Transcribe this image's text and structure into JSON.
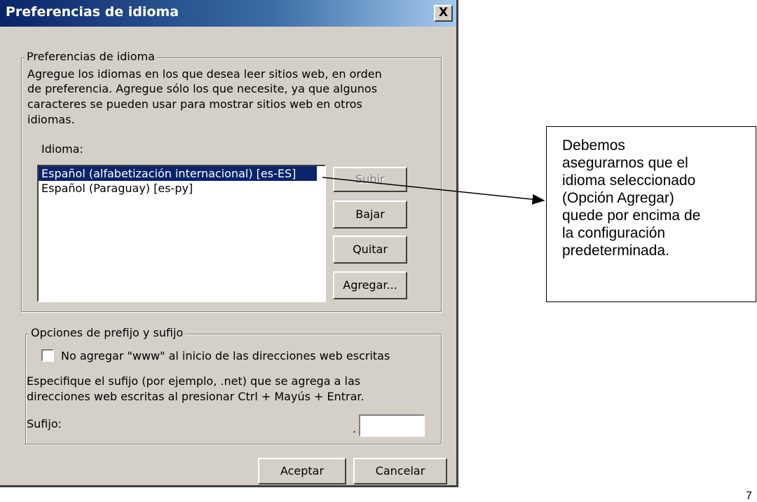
{
  "window": {
    "title": "Preferencias de idioma",
    "close_label": "X"
  },
  "language_group": {
    "legend": "Preferencias de idioma",
    "description_lines": [
      "Agregue los idiomas en los que desea leer sitios web, en orden",
      "de preferencia. Agregue sólo los que necesite, ya que algunos",
      "caracteres se pueden usar para mostrar sitios web en otros",
      "idiomas."
    ],
    "list_label": "Idioma:",
    "languages": [
      {
        "label": "Español (alfabetización internacional) [es-ES]",
        "selected": true
      },
      {
        "label": "Español (Paraguay) [es-py]",
        "selected": false
      }
    ],
    "buttons": {
      "up": "Subir",
      "down": "Bajar",
      "remove": "Quitar",
      "add": "Agregar..."
    }
  },
  "prefix_group": {
    "legend": "Opciones de prefijo y sufijo",
    "checkbox_label": "No agregar \"www\" al inicio de las direcciones web escritas",
    "checkbox_checked": false,
    "description_lines": [
      "Especifique el sufijo (por ejemplo, .net) que se agrega a las",
      "direcciones web escritas al presionar Ctrl + Mayús + Entrar."
    ],
    "suffix_label": "Sufijo:",
    "suffix_dot": ".",
    "suffix_value": ""
  },
  "footer": {
    "ok": "Aceptar",
    "cancel": "Cancelar"
  },
  "annotation": {
    "lines": [
      "Debemos",
      "asegurarnos que el",
      "idioma seleccionado",
      "(Opción Agregar)",
      "quede por encima de",
      "la configuración",
      "predeterminada."
    ]
  },
  "corner_mark": "7"
}
